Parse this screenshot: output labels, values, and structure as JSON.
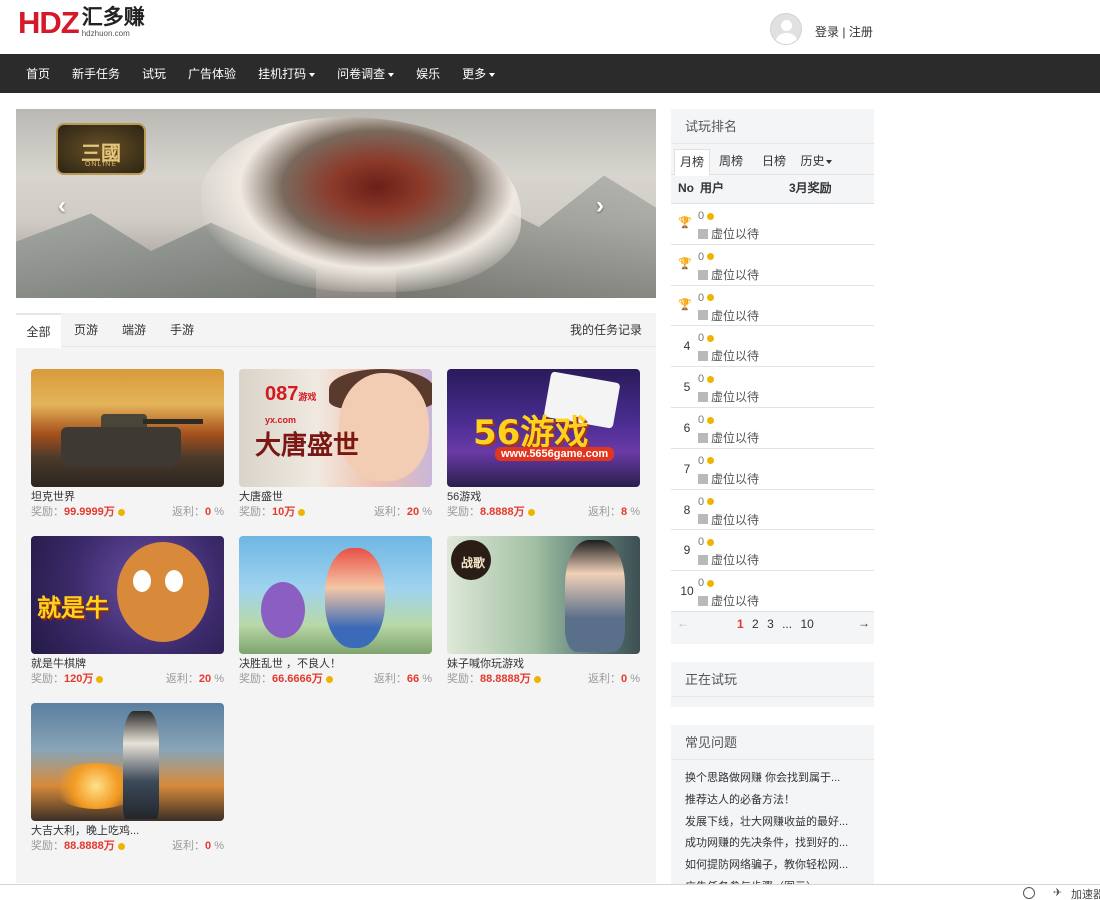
{
  "header": {
    "logo_mark": "HDZ",
    "logo_cn": "汇多赚",
    "logo_en": "hdzhuon.com",
    "login": "登录",
    "separator": "|",
    "register": "注册"
  },
  "nav": {
    "items": [
      {
        "label": "首页",
        "dropdown": false
      },
      {
        "label": "新手任务",
        "dropdown": false
      },
      {
        "label": "试玩",
        "dropdown": false
      },
      {
        "label": "广告体验",
        "dropdown": false
      },
      {
        "label": "挂机打码",
        "dropdown": true
      },
      {
        "label": "问卷调查",
        "dropdown": true
      },
      {
        "label": "娱乐",
        "dropdown": false
      },
      {
        "label": "更多",
        "dropdown": true
      }
    ]
  },
  "banner": {
    "emblem_text": "三國",
    "emblem_sub": "ONLINE",
    "prev": "‹",
    "next": "›"
  },
  "tabs": {
    "all": "全部",
    "web": "页游",
    "client": "端游",
    "mobile": "手游",
    "record": "我的任务记录"
  },
  "games": {
    "reward_label": "奖励：",
    "rebate_label": "返利：",
    "percent": "%",
    "items": [
      {
        "name": "坦克世界",
        "reward": "99.9999万",
        "rebate": "0"
      },
      {
        "name": "大唐盛世",
        "reward": "10万",
        "rebate": "20"
      },
      {
        "name": "56游戏",
        "reward": "8.8888万",
        "rebate": "8"
      },
      {
        "name": "就是牛棋牌",
        "reward": "120万",
        "rebate": "20"
      },
      {
        "name": "决胜乱世 ，不良人！",
        "reward": "66.6666万",
        "rebate": "66"
      },
      {
        "name": "妹子喊你玩游戏",
        "reward": "88.8888万",
        "rebate": "0"
      },
      {
        "name": "大吉大利，晚上吃鸡...",
        "reward": "88.8888万",
        "rebate": "0"
      }
    ],
    "thumb_texts": {
      "tang_logo": "087",
      "tang_logo_sub": "游戏",
      "tang_logo_site": "yx.com",
      "tang_title": "大唐盛世",
      "g56_big": "56游戏",
      "g56_url": "www.5656game.com",
      "bull_text": "就是牛",
      "mei_seal": "战歌"
    }
  },
  "ranking": {
    "title": "试玩排名",
    "tabs": {
      "month": "月榜",
      "week": "周榜",
      "day": "日榜",
      "history": "历史"
    },
    "head": {
      "no": "No",
      "user": "用户",
      "bonus": "3月奖励"
    },
    "rows": [
      {
        "no": "",
        "trophy": "gold",
        "value": "0",
        "user": "虚位以待"
      },
      {
        "no": "",
        "trophy": "silver",
        "value": "0",
        "user": "虚位以待"
      },
      {
        "no": "",
        "trophy": "bronze",
        "value": "0",
        "user": "虚位以待"
      },
      {
        "no": "4",
        "trophy": "",
        "value": "0",
        "user": "虚位以待"
      },
      {
        "no": "5",
        "trophy": "",
        "value": "0",
        "user": "虚位以待"
      },
      {
        "no": "6",
        "trophy": "",
        "value": "0",
        "user": "虚位以待"
      },
      {
        "no": "7",
        "trophy": "",
        "value": "0",
        "user": "虚位以待"
      },
      {
        "no": "8",
        "trophy": "",
        "value": "0",
        "user": "虚位以待"
      },
      {
        "no": "9",
        "trophy": "",
        "value": "0",
        "user": "虚位以待"
      },
      {
        "no": "10",
        "trophy": "",
        "value": "0",
        "user": "虚位以待"
      }
    ],
    "pager": {
      "prev": "←",
      "next": "→",
      "p1": "1",
      "p2": "2",
      "p3": "3",
      "ellipsis": "...",
      "p10": "10"
    },
    "colors": {
      "gold": "#e8b83c",
      "silver": "#e4e4e4",
      "bronze": "#b8641e"
    }
  },
  "playing": {
    "title": "正在试玩"
  },
  "faq": {
    "title": "常见问题",
    "items": [
      "换个思路做网赚 你会找到属于...",
      "推荐达人的必备方法！",
      "发展下线，壮大网赚收益的最好...",
      "成功网赚的先决条件，找到好的...",
      "如何提防网络骗子，教你轻松网...",
      "广告任务参与步骤（图示）"
    ]
  },
  "statusbar": {
    "text": "加速器"
  }
}
